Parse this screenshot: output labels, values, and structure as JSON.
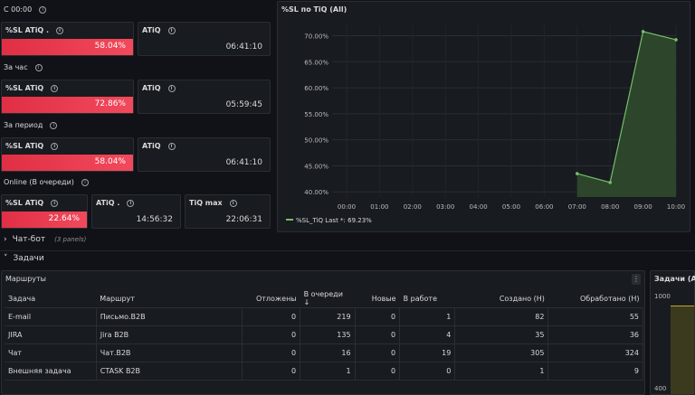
{
  "sections": [
    {
      "title": "С 00:00"
    },
    {
      "title": "За час"
    },
    {
      "title": "За период"
    },
    {
      "title": "Online (В очереди)"
    }
  ],
  "stats": {
    "s1_sl": {
      "title": "%SL ATiQ .",
      "value": "58.04%"
    },
    "s1_atiq": {
      "title": "ATiQ",
      "value": "06:41:10"
    },
    "s2_sl": {
      "title": "%SL ATiQ",
      "value": "72.86%"
    },
    "s2_atiq": {
      "title": "ATiQ",
      "value": "05:59:45"
    },
    "s3_sl": {
      "title": "%SL ATiQ",
      "value": "58.04%"
    },
    "s3_atiq": {
      "title": "ATiQ",
      "value": "06:41:10"
    },
    "s4_sl": {
      "title": "%SL ATiQ",
      "value": "22.64%"
    },
    "s4_atiq": {
      "title": "ATiQ .",
      "value": "14:56:32"
    },
    "s4_tiqmax": {
      "title": "TiQ max",
      "value": "22:06:31"
    }
  },
  "chart_panel": {
    "title": "%SL по TiQ (All)"
  },
  "chart_data": {
    "type": "area",
    "x": [
      "00:00",
      "01:00",
      "02:00",
      "03:00",
      "04:00",
      "05:00",
      "06:00",
      "07:00",
      "08:00",
      "09:00",
      "10:00"
    ],
    "series": [
      {
        "name": "%SL_TiQ",
        "values": [
          null,
          null,
          null,
          null,
          null,
          null,
          null,
          43.5,
          41.8,
          70.8,
          69.23
        ]
      }
    ],
    "yticks": [
      "70.00%",
      "65.00%",
      "60.00%",
      "55.00%",
      "50.00%",
      "45.00%",
      "40.00%"
    ],
    "ylim": [
      39,
      72
    ],
    "legend": {
      "name": "%SL_TiQ",
      "last": "Last *: 69.23%"
    },
    "colors": {
      "line": "#73bf69",
      "fill": "#2f4a2c"
    }
  },
  "rows": {
    "chatbot": {
      "label": "Чат-бот",
      "sub": "(3 panels)"
    },
    "tasks": {
      "label": "Задачи"
    }
  },
  "table_panel": {
    "title": "Маршруты"
  },
  "table": {
    "headers": [
      "Задача",
      "Маршрут",
      "Отложены",
      "В очереди ↓",
      "Новые",
      "В работе",
      "Создано (Н)",
      "Обработано (Н)"
    ],
    "rows": [
      [
        "E-mail",
        "Письмо.B2B",
        "0",
        "219",
        "0",
        "1",
        "82",
        "55"
      ],
      [
        "JIRA",
        "Jira B2B",
        "0",
        "135",
        "0",
        "4",
        "35",
        "36"
      ],
      [
        "Чат",
        "Чат.B2B",
        "0",
        "16",
        "0",
        "19",
        "305",
        "324"
      ],
      [
        "Внешняя задача",
        "CTASK B2B",
        "0",
        "1",
        "0",
        "0",
        "1",
        "9"
      ]
    ]
  },
  "side_panel": {
    "title": "Задачи (All)",
    "tick_top": "1000",
    "tick_bottom": "400"
  }
}
